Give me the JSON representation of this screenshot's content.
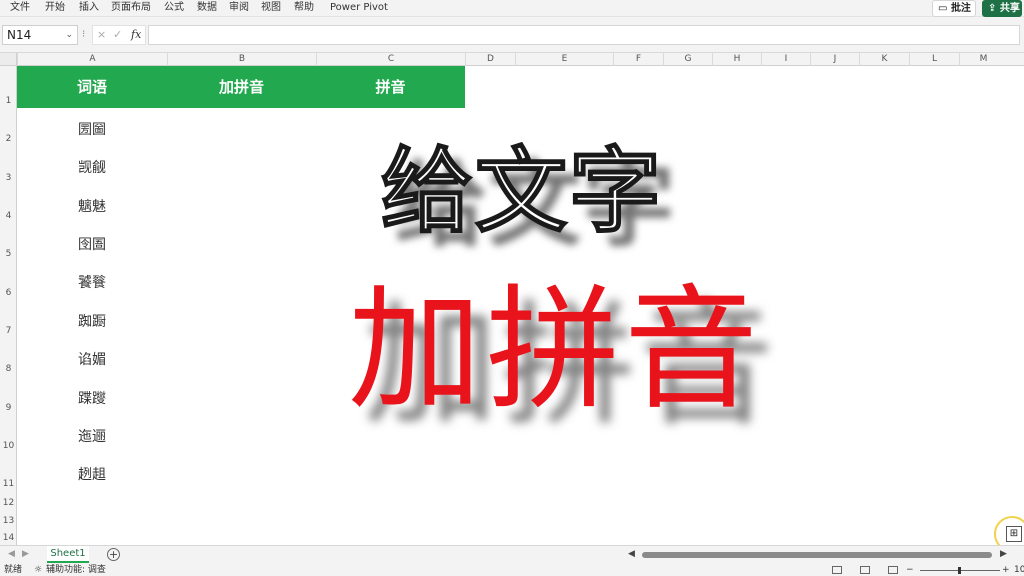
{
  "menu": {
    "items": [
      "文件",
      "开始",
      "插入",
      "页面布局",
      "公式",
      "数据",
      "审阅",
      "视图",
      "帮助",
      "Power Pivot"
    ],
    "comment_btn": "批注",
    "share_btn": "共享"
  },
  "formula_bar": {
    "name_box": "N14",
    "fx_label": "fx",
    "cancel": "×",
    "enter": "✓",
    "value": ""
  },
  "columns": [
    "A",
    "B",
    "C",
    "D",
    "E",
    "F",
    "G",
    "H",
    "I",
    "J",
    "K",
    "L",
    "M"
  ],
  "rows": [
    "1",
    "2",
    "3",
    "4",
    "5",
    "6",
    "7",
    "8",
    "9",
    "10",
    "11",
    "12",
    "13",
    "14"
  ],
  "table": {
    "headers": [
      "词语",
      "加拼音",
      "拼音"
    ],
    "header_color": "#22a94f",
    "words": [
      "圐圙",
      "觊觎",
      "魑魅",
      "囹圄",
      "饕餮",
      "踟蹰",
      "谄媚",
      "蹀躞",
      "迤逦",
      "趔趄"
    ]
  },
  "overlay": {
    "line1": "给文字",
    "line2": "加拼音",
    "line2_color": "#e8131b"
  },
  "sheet_tabs": {
    "active": "Sheet1",
    "add_label": "+"
  },
  "status": {
    "ready": "就绪",
    "accessibility": "辅助功能: 调查",
    "zoom": "10"
  }
}
